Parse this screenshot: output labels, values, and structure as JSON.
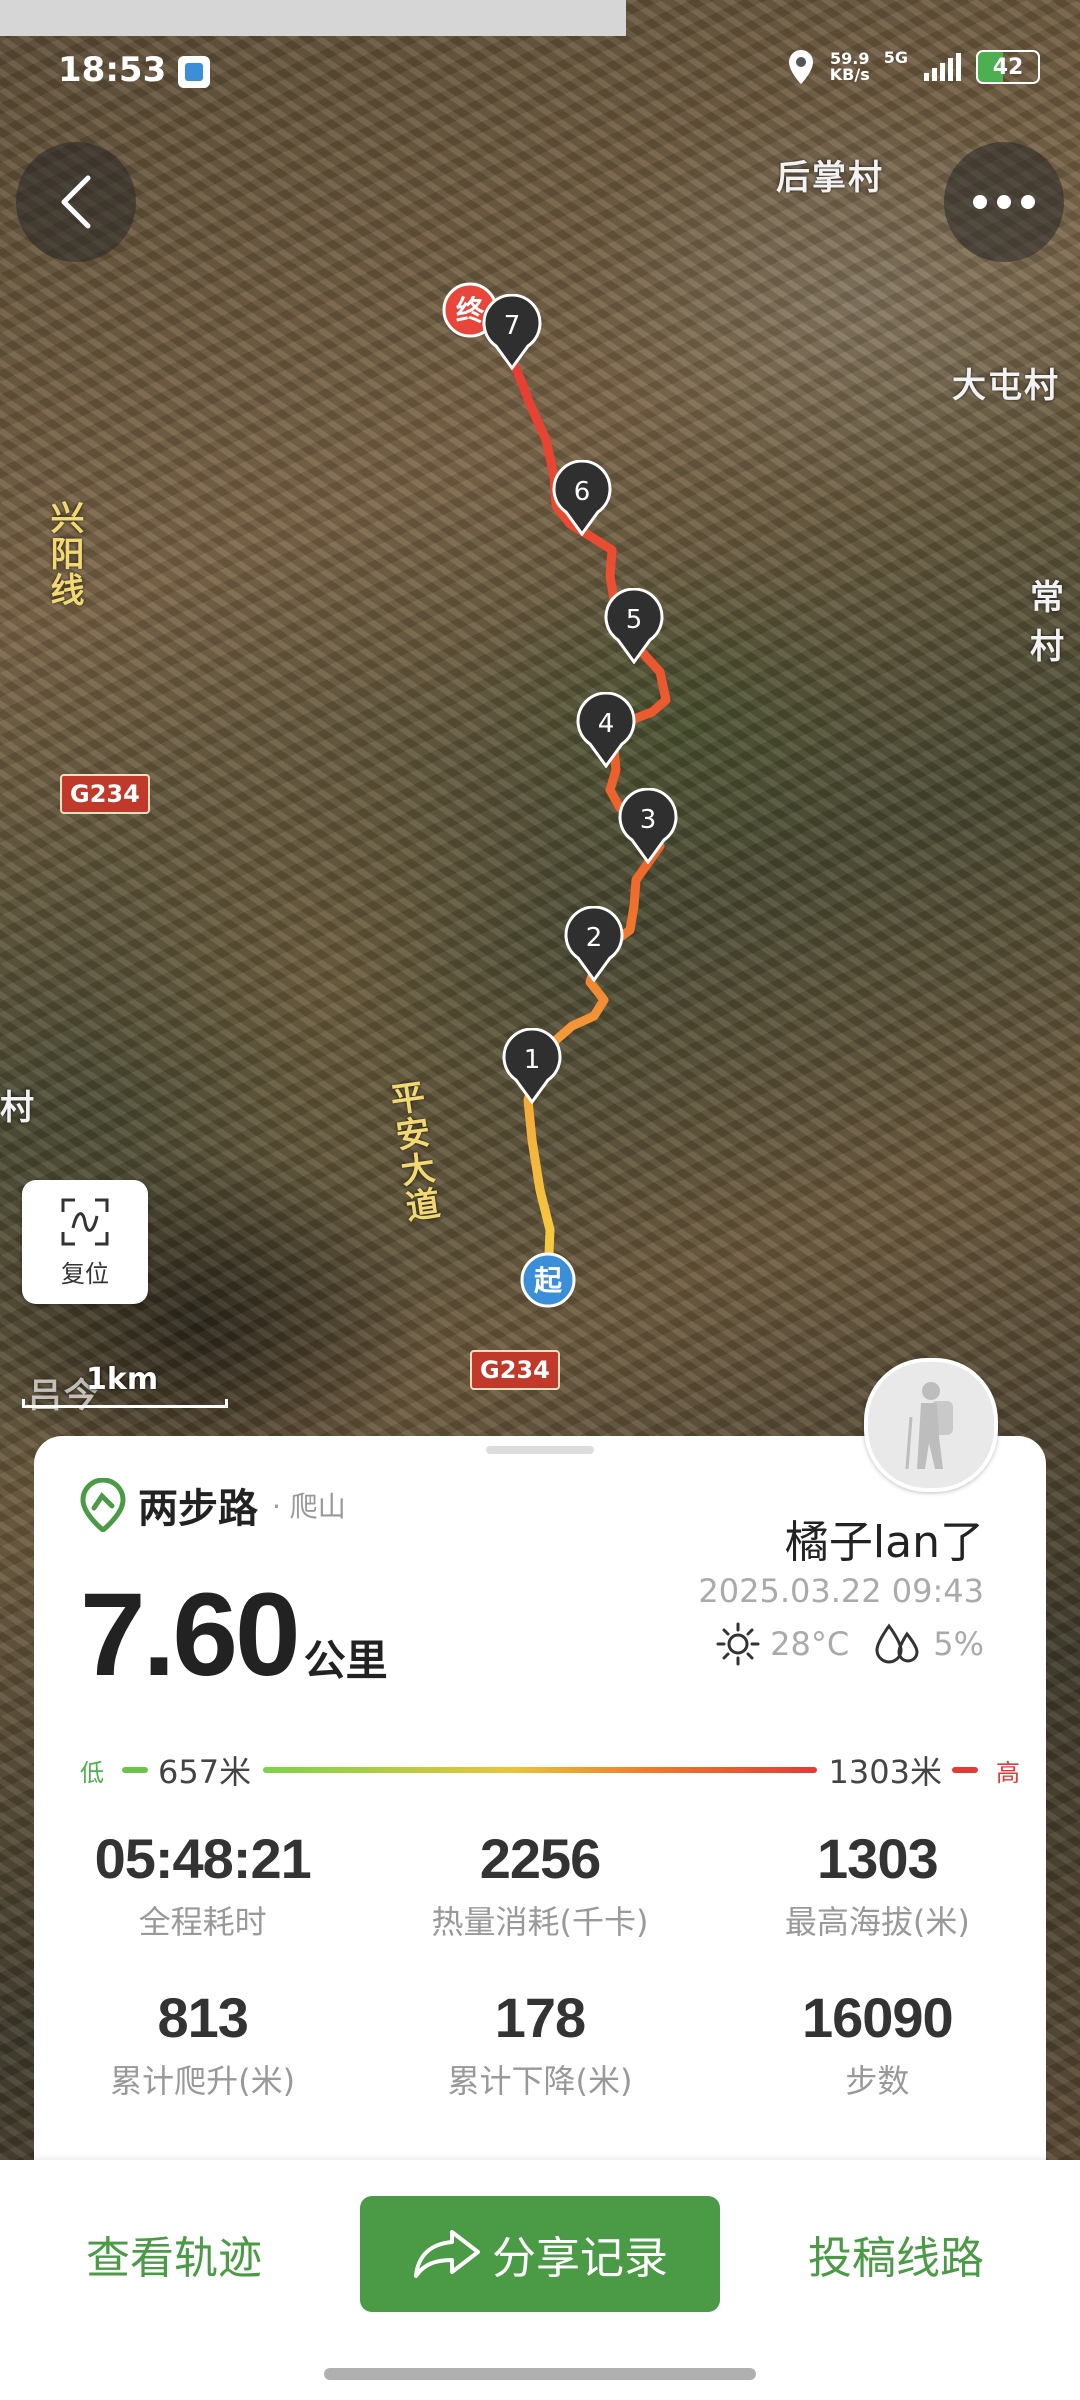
{
  "status_bar": {
    "time": "18:53",
    "network_speed": "59.9\nKB/s",
    "network_type": "5G",
    "battery": "42"
  },
  "map": {
    "labels": {
      "village_1": "后掌村",
      "village_2": "大屯村",
      "village_3": "常村",
      "road_1": "兴阳线",
      "road_2": "平安大道",
      "left_edge": "村",
      "bottom_left": "吕今"
    },
    "road_badges": [
      "G234",
      "G234"
    ],
    "start_label": "起",
    "end_label": "终",
    "waypoints": [
      "1",
      "2",
      "3",
      "4",
      "5",
      "6",
      "7"
    ],
    "reset_label": "复位",
    "scale_label": "1km"
  },
  "card": {
    "brand_name": "两步路",
    "brand_sub": "· 爬山",
    "distance_value": "7.60",
    "distance_unit": "公里",
    "user_name": "橘子lan了",
    "date": "2025.03.22 09:43",
    "temperature": "28°C",
    "humidity": "5%",
    "altitude": {
      "low_label": "低",
      "low_value": "657米",
      "high_value": "1303米",
      "high_label": "高"
    },
    "stats": [
      {
        "value": "05:48:21",
        "label": "全程耗时"
      },
      {
        "value": "2256",
        "label": "热量消耗(千卡)"
      },
      {
        "value": "1303",
        "label": "最高海拔(米)"
      },
      {
        "value": "813",
        "label": "累计爬升(米)"
      },
      {
        "value": "178",
        "label": "累计下降(米)"
      },
      {
        "value": "16090",
        "label": "步数"
      }
    ]
  },
  "bottom_bar": {
    "view_track": "查看轨迹",
    "share": "分享记录",
    "submit_route": "投稿线路"
  },
  "colors": {
    "brand_green": "#4a9a46",
    "track_start": "#f5d142",
    "track_end": "#e53935"
  }
}
